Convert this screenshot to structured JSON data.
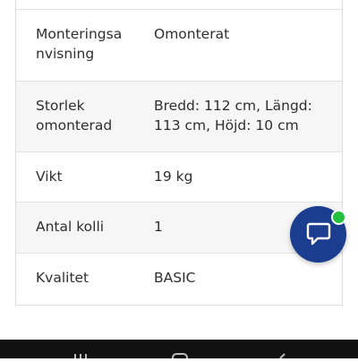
{
  "specs": [
    {
      "label": "Monteringsa nvisning",
      "value": "Omonterat"
    },
    {
      "label": "Storlek omonterad",
      "value": "Bredd: 112 cm, Längd: 113 cm, Höjd: 10 cm"
    },
    {
      "label": "Vikt",
      "value": "19 kg"
    },
    {
      "label": "Antal kolli",
      "value": "1"
    },
    {
      "label": "Kvalitet",
      "value": "BASIC"
    }
  ],
  "chat": {
    "icon": "chat-bubble-icon",
    "status_color": "#23c13f",
    "accent": "#1b3d8f"
  },
  "navbar": {
    "buttons": [
      "recent-apps-icon",
      "home-icon",
      "back-icon"
    ]
  }
}
